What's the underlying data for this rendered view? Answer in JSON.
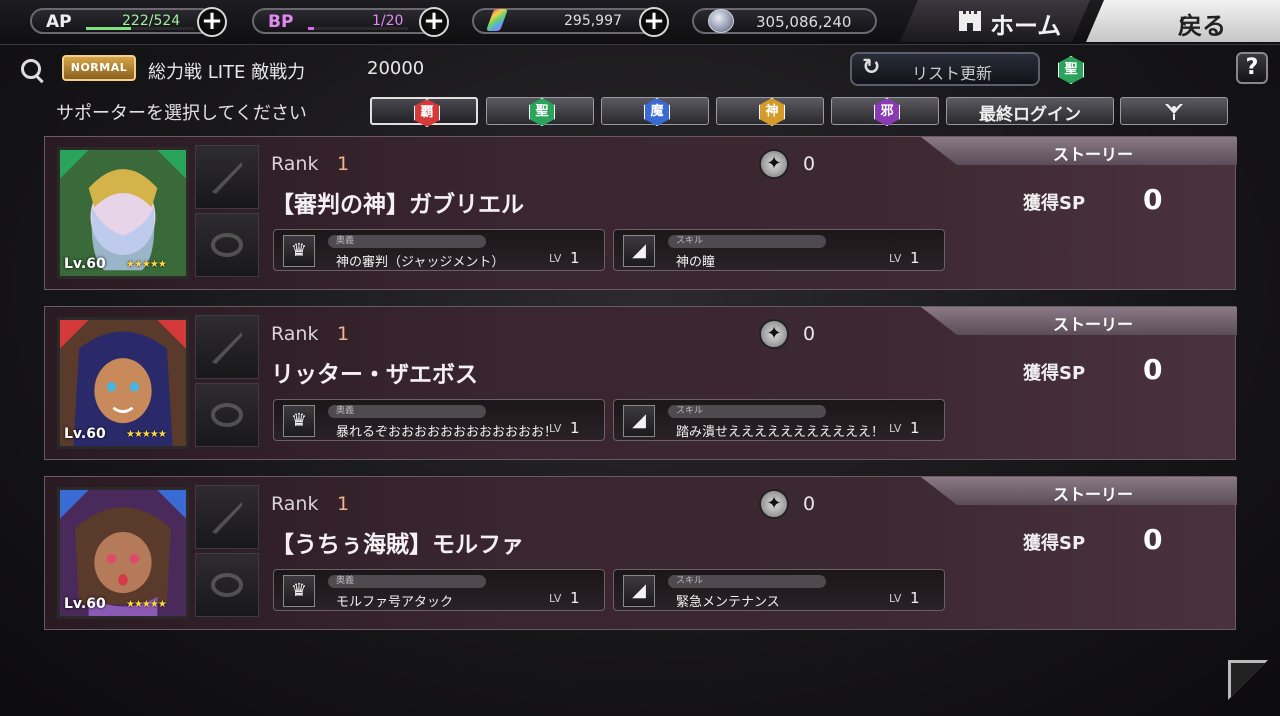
{
  "resources": {
    "ap": {
      "label": "AP",
      "current": "222",
      "max": "524",
      "display": "222/524",
      "fill": 0.42,
      "color": "#7fe07f"
    },
    "bp": {
      "label": "BP",
      "current": "1",
      "max": "20",
      "display": "1/20",
      "fill": 0.05,
      "color": "#d96af0"
    },
    "gems": {
      "value": "295,997"
    },
    "coins": {
      "value": "305,086,240"
    }
  },
  "nav": {
    "home_label": "ホーム",
    "back_label": "戻る"
  },
  "header": {
    "difficulty_badge": "NORMAL",
    "battle_title": "総力戦 LITE 敵戦力",
    "enemy_power": "20000",
    "refresh_label": "リスト更新",
    "current_attribute": "聖",
    "help_label": "?"
  },
  "filter": {
    "prompt": "サポーターを選択してください",
    "attributes": [
      {
        "label": "覇",
        "color": "#d43a3a"
      },
      {
        "label": "聖",
        "color": "#2aa45a"
      },
      {
        "label": "魔",
        "color": "#3a6ad4"
      },
      {
        "label": "神",
        "color": "#d49a2a"
      },
      {
        "label": "邪",
        "color": "#8a3ab4"
      }
    ],
    "sort_label": "最終ログイン"
  },
  "supporters": [
    {
      "rank_label": "Rank",
      "rank": "1",
      "stars_count": "0",
      "name": "【審判の神】ガブリエル",
      "level": "Lv.60",
      "rarity": "★★★★★",
      "ougi_tag": "奥義",
      "ougi_name": "神の審判（ジャッジメント）",
      "ougi_lv_label": "LV",
      "ougi_lv": "1",
      "skill_tag": "スキル",
      "skill_name": "神の瞳",
      "skill_lv_label": "LV",
      "skill_lv": "1",
      "story_label": "ストーリー",
      "sp_label": "獲得SP",
      "sp_value": "0",
      "frame_color": "#2aa45a"
    },
    {
      "rank_label": "Rank",
      "rank": "1",
      "stars_count": "0",
      "name": "リッター・ザエボス",
      "level": "Lv.60",
      "rarity": "★★★★★",
      "ougi_tag": "奥義",
      "ougi_name": "暴れるぞおおおおおおおおおおおお！",
      "ougi_lv_label": "LV",
      "ougi_lv": "1",
      "skill_tag": "スキル",
      "skill_name": "踏み潰せえええええええええええ！",
      "skill_lv_label": "LV",
      "skill_lv": "1",
      "story_label": "ストーリー",
      "sp_label": "獲得SP",
      "sp_value": "0",
      "frame_color": "#d43a3a"
    },
    {
      "rank_label": "Rank",
      "rank": "1",
      "stars_count": "0",
      "name": "【うちぅ海賊】モルファ",
      "level": "Lv.60",
      "rarity": "★★★★★",
      "ougi_tag": "奥義",
      "ougi_name": "モルファ号アタック",
      "ougi_lv_label": "LV",
      "ougi_lv": "1",
      "skill_tag": "スキル",
      "skill_name": "緊急メンテナンス",
      "skill_lv_label": "LV",
      "skill_lv": "1",
      "story_label": "ストーリー",
      "sp_label": "獲得SP",
      "sp_value": "0",
      "frame_color": "#3a6ad4"
    }
  ]
}
